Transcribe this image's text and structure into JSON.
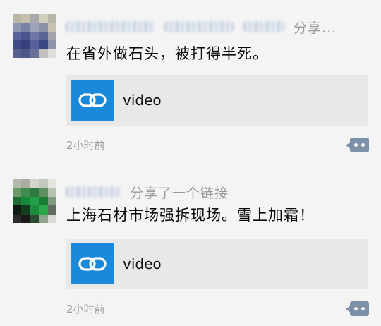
{
  "colors": {
    "link_thumb": "#1a89d9",
    "comment_button": "#7c90a7",
    "meta_text": "#9b9b9b",
    "card_bg": "#e8e8e8"
  },
  "posts": [
    {
      "share_label": "分享...",
      "content": "在省外做石头，被打得半死。",
      "link": {
        "icon": "link-icon",
        "title": "video"
      },
      "time": "2小时前",
      "comment_icon": "comment-bubble-icon"
    },
    {
      "share_label": "分享了一个链接",
      "content": "上海石材市场强拆现场。雪上加霜！",
      "link": {
        "icon": "link-icon",
        "title": "video"
      },
      "time": "2小时前",
      "comment_icon": "comment-bubble-icon"
    }
  ]
}
